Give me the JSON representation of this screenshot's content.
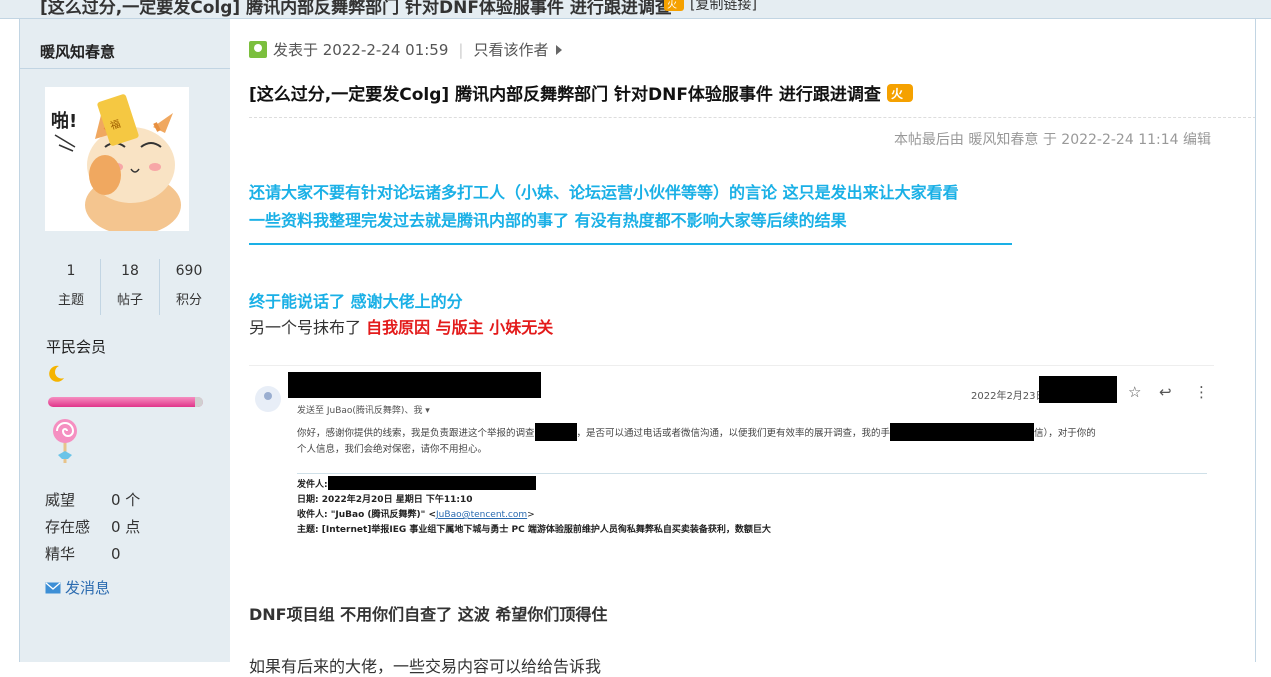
{
  "thread": {
    "title": "[这么过分,一定要发Colg] 腾讯内部反舞弊部门 针对DNF体验服事件 进行跟进调查",
    "copy_link": "[复制链接]"
  },
  "author": {
    "name": "暖风知春意",
    "stats": [
      {
        "value": "1",
        "label": "主题"
      },
      {
        "value": "18",
        "label": "帖子"
      },
      {
        "value": "690",
        "label": "积分"
      }
    ],
    "group": "平民会员",
    "props": [
      {
        "key": "威望",
        "value": "0 个"
      },
      {
        "key": "存在感",
        "value": "0 点"
      },
      {
        "key": "精华",
        "value": "0"
      }
    ],
    "send_message": "发消息"
  },
  "post": {
    "posted_at": "发表于 2022-2-24 01:59",
    "only_author": "只看该作者",
    "title": "[这么过分,一定要发Colg] 腾讯内部反舞弊部门 针对DNF体验服事件 进行跟进调查",
    "last_edit": "本帖最后由 暖风知春意 于 2022-2-24 11:14 编辑",
    "line1": "还请大家不要有针对论坛诸多打工人（小妹、论坛运营小伙伴等等）的言论 这只是发出来让大家看看",
    "line2": "一些资料我整理完发过去就是腾讯内部的事了 有没有热度都不影响大家等后续的结果",
    "line3": "终于能说话了 感谢大佬上的分",
    "line4_prefix": "另一个号抹布了 ",
    "line4_red": "自我原因 与版主 小妹无关",
    "line5": "DNF项目组 不用你们自查了 这波 希望你们顶得住",
    "line6": "如果有后来的大佬，一些交易内容可以给给告诉我"
  },
  "email": {
    "date": "2022年2月23日",
    "to": "发送至 JuBao(腾讯反舞弊)、我 ▾",
    "body1a": "你好，感谢你提供的线索，我是负责跟进这个举报的调查",
    "body1b": "，是否可以通过电话或者微信沟通，以便我们更有效率的展开调查，我的手",
    "body1c": "信），对于你的",
    "body2": "个人信息，我们会绝对保密，请你不用担心。",
    "fwd_from": "发件人:",
    "fwd_date": "日期: 2022年2月20日 星期日 下午11:10",
    "fwd_to_prefix": "收件人: \"JuBao (腾讯反舞弊)\" <",
    "fwd_to_link": "JuBao@tencent.com",
    "fwd_to_suffix": ">",
    "fwd_subject": "主题: [Internet]举报IEG 事业组下属地下城与勇士 PC 端游体验服前维护人员徇私舞弊私自买卖装备获利，数额巨大"
  },
  "colors": {
    "sidebar_bg": "#e5edf2",
    "accent_cyan": "#1ab0e6",
    "accent_red": "#e31b1b",
    "link_blue": "#2b6bb0"
  }
}
